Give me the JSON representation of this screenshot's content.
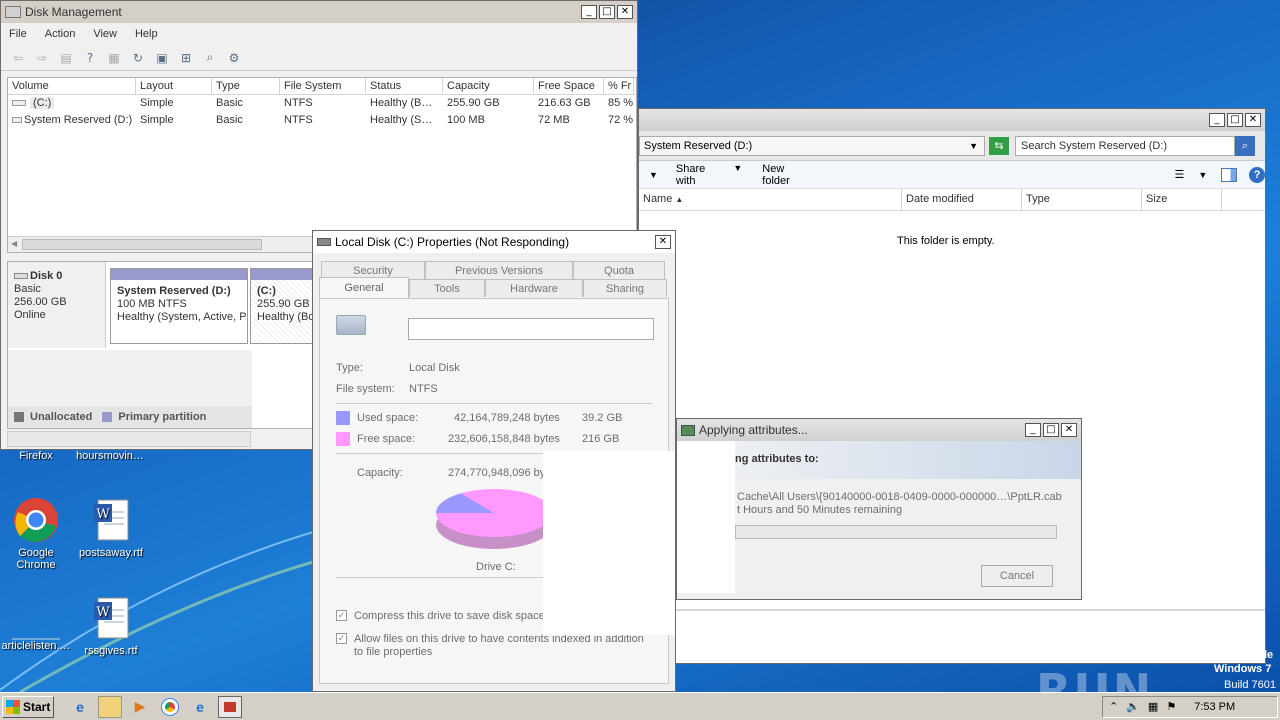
{
  "colors": {
    "accent": "#1e7fd6",
    "used": "#9999ff",
    "free": "#ff99ff"
  },
  "disk_mgmt": {
    "title": "Disk Management",
    "menu": [
      "File",
      "Action",
      "View",
      "Help"
    ],
    "columns": [
      "Volume",
      "Layout",
      "Type",
      "File System",
      "Status",
      "Capacity",
      "Free Space",
      "% Fr"
    ],
    "rows": [
      [
        "(C:)",
        "Simple",
        "Basic",
        "NTFS",
        "Healthy (B…",
        "255.90 GB",
        "216.63 GB",
        "85 %"
      ],
      [
        "System Reserved (D:)",
        "Simple",
        "Basic",
        "NTFS",
        "Healthy (S…",
        "100 MB",
        "72 MB",
        "72 %"
      ]
    ],
    "disk": {
      "name": "Disk 0",
      "kind": "Basic",
      "size": "256.00 GB",
      "state": "Online"
    },
    "part1": {
      "name": "System Reserved  (D:)",
      "size": "100 MB NTFS",
      "status": "Healthy (System, Active, P"
    },
    "part2": {
      "name": "(C:)",
      "size": "255.90 GB",
      "status": "Healthy (Bo"
    },
    "legend": [
      "Unallocated",
      "Primary partition"
    ]
  },
  "explorer": {
    "address": "System Reserved (D:)",
    "search_placeholder": "Search System Reserved (D:)",
    "share_label": "Share with",
    "newfolder_label": "New folder",
    "columns": [
      "Name",
      "Date modified",
      "Type",
      "Size"
    ],
    "empty_text": "This folder is empty."
  },
  "props": {
    "title": "Local Disk (C:) Properties (Not Responding)",
    "tabs_back": [
      "Security",
      "Previous Versions",
      "Quota"
    ],
    "tabs_front": [
      "General",
      "Tools",
      "Hardware",
      "Sharing"
    ],
    "type_label": "Type:",
    "type_value": "Local Disk",
    "fs_label": "File system:",
    "fs_value": "NTFS",
    "used_label": "Used space:",
    "used_bytes": "42,164,789,248 bytes",
    "used_gb": "39.2 GB",
    "free_label": "Free space:",
    "free_bytes": "232,606,158,848 bytes",
    "free_gb": "216 GB",
    "cap_label": "Capacity:",
    "cap_bytes": "274,770,948,096 byt",
    "drive_label": "Drive C:",
    "compress": "Compress this drive to save disk space",
    "index": "Allow files on this drive to have contents indexed in addition to file properties",
    "used_fraction": 0.153
  },
  "applying": {
    "title": "Applying attributes...",
    "heading": "ng attributes to:",
    "path": "Cache\\All Users\\{90140000-0018-0409-0000-000000…\\PptLR.cab",
    "remaining": "t Hours and 50 Minutes remaining",
    "cancel": "Cancel"
  },
  "desktop": {
    "icons": [
      "Firefox",
      "hoursmovin…",
      "Google Chrome",
      "postsaway.rtf",
      "articlelisten.…",
      "rssgives.rtf"
    ]
  },
  "watermark": {
    "text": "ANY RUN",
    "os": "Windows 7",
    "build": "Build 7601",
    "edge": "le"
  },
  "taskbar": {
    "start": "Start",
    "clock": "7:53 PM"
  }
}
